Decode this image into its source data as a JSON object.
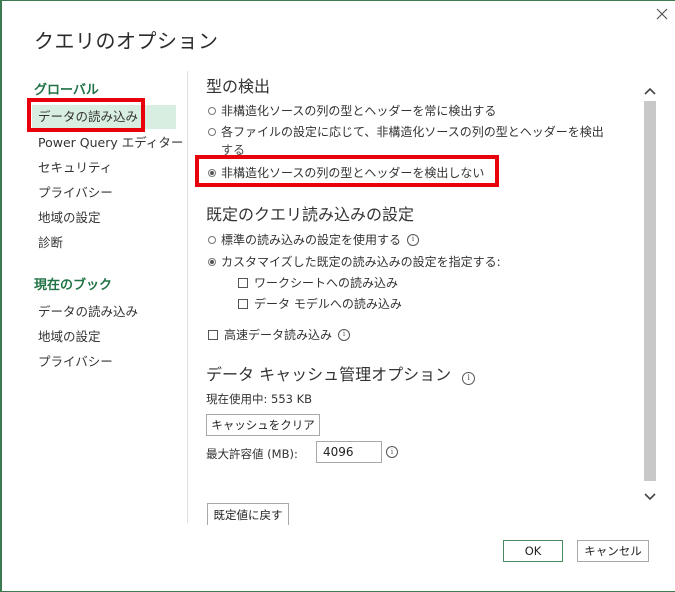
{
  "dialog": {
    "title": "クエリのオプション"
  },
  "nav": {
    "global_header": "グローバル",
    "global_items": [
      {
        "label": "データの読み込み"
      },
      {
        "label": "Power Query エディター"
      },
      {
        "label": "セキュリティ"
      },
      {
        "label": "プライバシー"
      },
      {
        "label": "地域の設定"
      },
      {
        "label": "診断"
      }
    ],
    "workbook_header": "現在のブック",
    "workbook_items": [
      {
        "label": "データの読み込み"
      },
      {
        "label": "地域の設定"
      },
      {
        "label": "プライバシー"
      }
    ]
  },
  "type_detection": {
    "heading": "型の検出",
    "options": [
      {
        "label": "非構造化ソースの列の型とヘッダーを常に検出する",
        "checked": false
      },
      {
        "label": "各ファイルの設定に応じて、非構造化ソースの列の型とヘッダーを検出",
        "label_wrap": "する",
        "checked": false
      },
      {
        "label": "非構造化ソースの列の型とヘッダーを検出しない",
        "checked": true
      }
    ]
  },
  "default_load": {
    "heading": "既定のクエリ読み込みの設定",
    "options": [
      {
        "label": "標準の読み込みの設定を使用する",
        "checked": false
      },
      {
        "label": "カスタマイズした既定の読み込みの設定を指定する:",
        "checked": true
      }
    ],
    "sub_options": [
      {
        "label": "ワークシートへの読み込み",
        "checked": false
      },
      {
        "label": "データ モデルへの読み込み",
        "checked": false
      }
    ],
    "fast_load": {
      "label": "高速データ読み込み",
      "checked": false
    }
  },
  "cache": {
    "heading": "データ キャッシュ管理オプション",
    "current_usage": "現在使用中: 553 KB",
    "clear_button": "キャッシュをクリア",
    "max_label": "最大許容値 (MB):",
    "max_value": "4096"
  },
  "buttons": {
    "restore_defaults": "既定値に戻す",
    "ok": "OK",
    "cancel": "キャンセル"
  },
  "icons": {
    "close": "×",
    "info": "i",
    "scroll_up": "chevron-up-icon",
    "scroll_down": "chevron-down-icon"
  },
  "colors": {
    "accent": "#217346",
    "highlight": "#e8000b",
    "selected_bg": "#d8eee0"
  }
}
